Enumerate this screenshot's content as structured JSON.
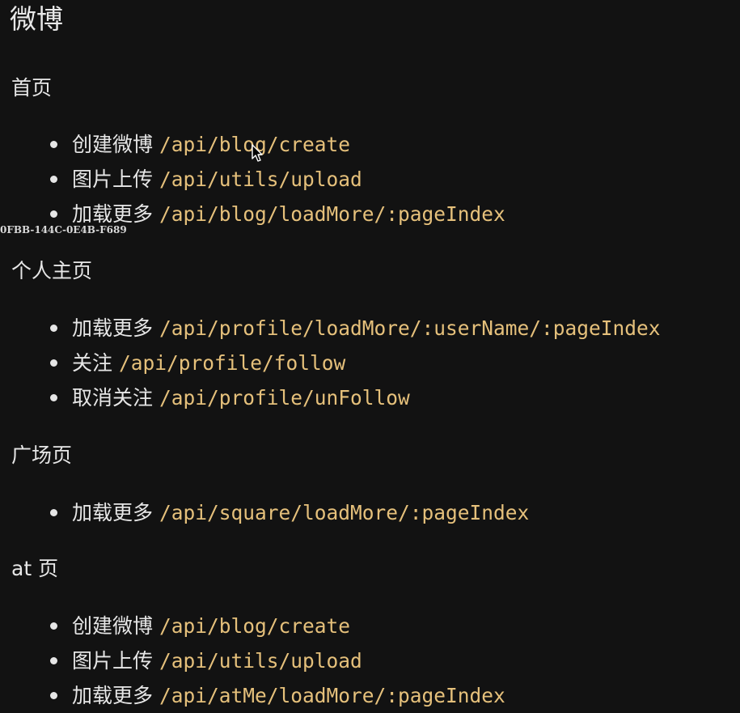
{
  "title": "微博",
  "watermark": "0FBB-144C-0E4B-F689",
  "sections": [
    {
      "heading": "首页",
      "items": [
        {
          "label": "创建微博",
          "path": "/api/blog/create"
        },
        {
          "label": "图片上传",
          "path": "/api/utils/upload"
        },
        {
          "label": "加载更多",
          "path": "/api/blog/loadMore/:pageIndex"
        }
      ]
    },
    {
      "heading": "个人主页",
      "items": [
        {
          "label": "加载更多",
          "path": "/api/profile/loadMore/:userName/:pageIndex"
        },
        {
          "label": "关注",
          "path": "/api/profile/follow"
        },
        {
          "label": "取消关注",
          "path": "/api/profile/unFollow"
        }
      ]
    },
    {
      "heading": "广场页",
      "items": [
        {
          "label": "加载更多",
          "path": "/api/square/loadMore/:pageIndex"
        }
      ]
    },
    {
      "heading": "at 页",
      "items": [
        {
          "label": "创建微博",
          "path": "/api/blog/create"
        },
        {
          "label": "图片上传",
          "path": "/api/utils/upload"
        },
        {
          "label": "加载更多",
          "path": "/api/atMe/loadMore/:pageIndex"
        }
      ]
    }
  ],
  "colors": {
    "background": "#121212",
    "text": "#e6e6e6",
    "path": "#e5c07b"
  },
  "cursor_icon": "mouse-pointer-icon"
}
